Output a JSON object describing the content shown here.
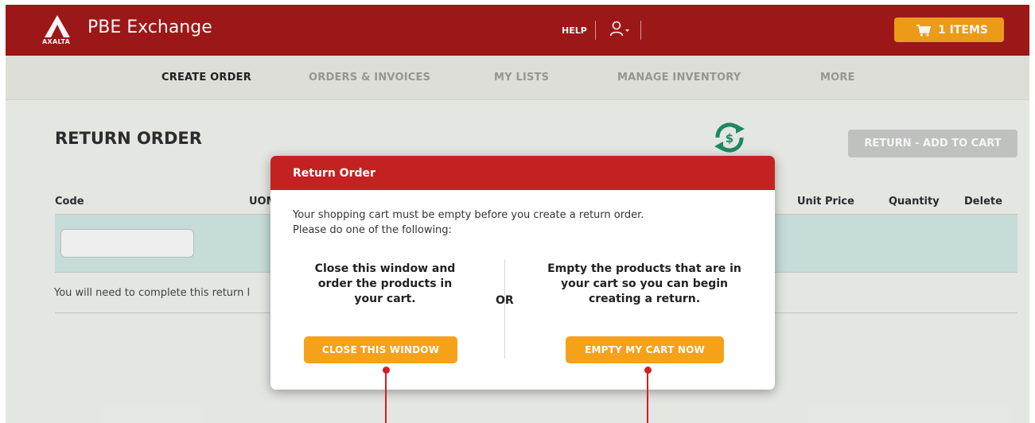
{
  "header": {
    "brand_logo_text": "AXALTA",
    "app_title": "PBE Exchange",
    "help_label": "HELP",
    "cart_label": "1 ITEMS",
    "colors": {
      "header_bg": "#a31818",
      "accent": "#f5a21a"
    }
  },
  "nav": {
    "items": [
      {
        "label": "CREATE ORDER",
        "active": true
      },
      {
        "label": "ORDERS & INVOICES",
        "active": false
      },
      {
        "label": "MY LISTS",
        "active": false
      },
      {
        "label": "MANAGE INVENTORY",
        "active": false
      },
      {
        "label": "MORE",
        "active": false
      }
    ]
  },
  "page": {
    "title": "RETURN ORDER",
    "return_add_label": "RETURN - ADD TO CART",
    "columns": [
      "Code",
      "UOM",
      "Unit Price",
      "Quantity",
      "Delete"
    ],
    "code_input_value": "",
    "note": "You will need to complete this return l"
  },
  "modal": {
    "title": "Return Order",
    "message_line1": "Your shopping cart must be empty before you create a return order.",
    "message_line2": "Please do one of the following:",
    "left_option_line1": "Close this window and",
    "left_option_line2": "order the products in",
    "left_option_line3": "your cart.",
    "or_label": "OR",
    "right_option_line1": "Empty the products that are in",
    "right_option_line2": "your cart so you can begin",
    "right_option_line3": "creating a return.",
    "close_button": "CLOSE THIS WINDOW",
    "empty_button": "EMPTY MY CART NOW"
  }
}
